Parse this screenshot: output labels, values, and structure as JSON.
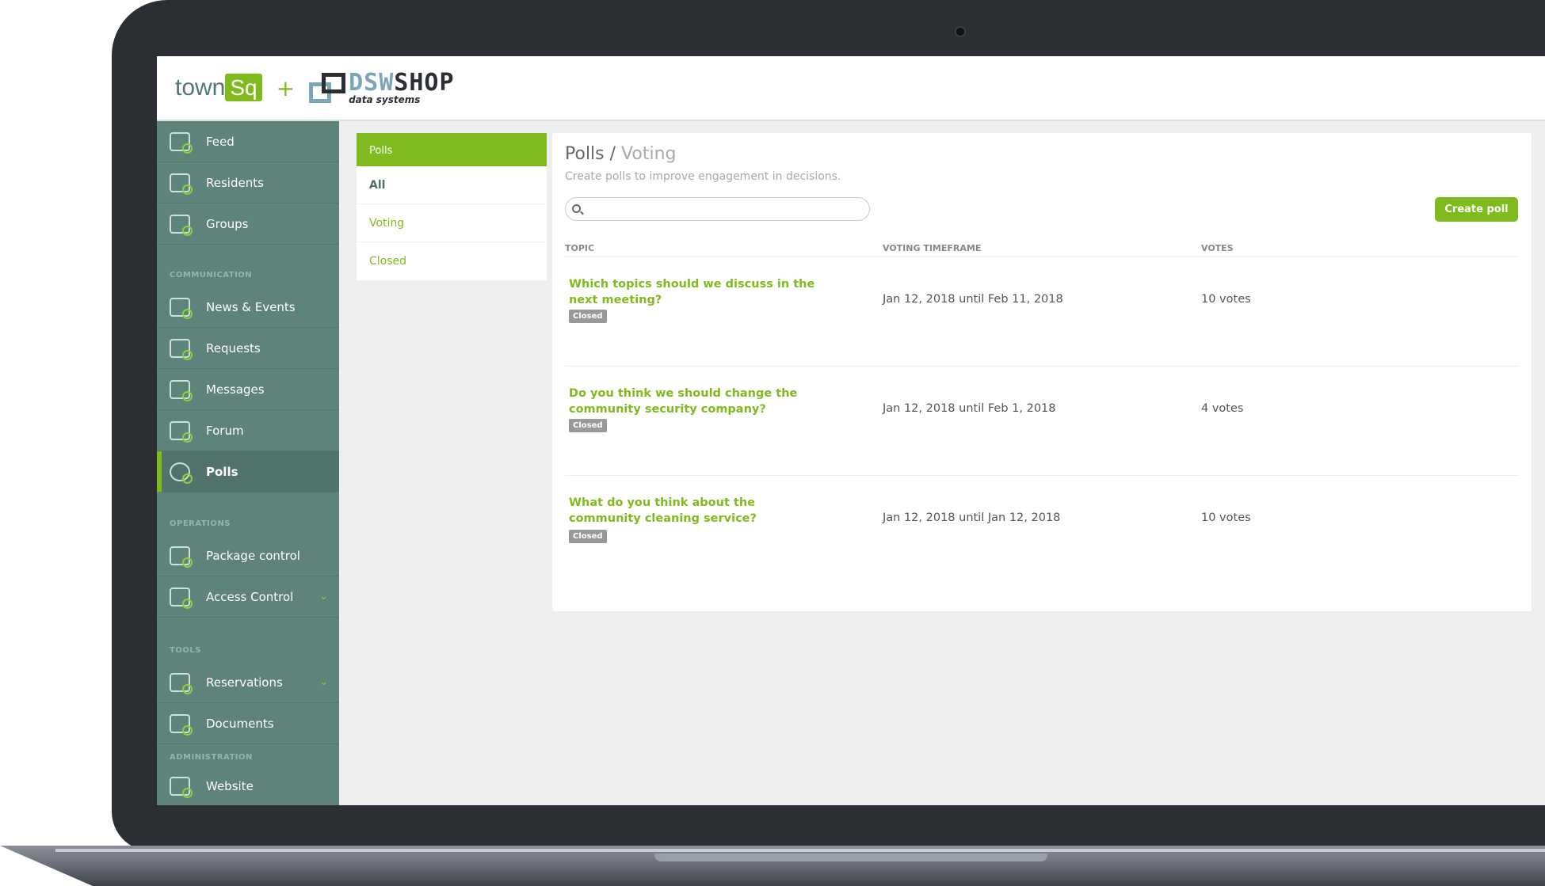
{
  "header": {
    "logo_left": "townSq",
    "logo_plus": "+",
    "logo_right": "DSWSHOP",
    "logo_right_sub": "data systems"
  },
  "sidebar": {
    "items": [
      {
        "label": "Feed",
        "icon": "feed-icon"
      },
      {
        "label": "Residents",
        "icon": "residents-icon"
      },
      {
        "label": "Groups",
        "icon": "groups-icon"
      },
      {
        "label": "News & Events",
        "icon": "news-events-icon"
      },
      {
        "label": "Requests",
        "icon": "requests-icon"
      },
      {
        "label": "Messages",
        "icon": "messages-icon"
      },
      {
        "label": "Forum",
        "icon": "forum-icon"
      },
      {
        "label": "Polls",
        "icon": "polls-icon",
        "active": true
      },
      {
        "label": "Package control",
        "icon": "package-icon"
      },
      {
        "label": "Access Control",
        "icon": "key-icon",
        "expandable": true
      },
      {
        "label": "Reservations",
        "icon": "calendar-icon",
        "expandable": true
      },
      {
        "label": "Documents",
        "icon": "document-icon"
      },
      {
        "label": "Website",
        "icon": "website-icon"
      }
    ],
    "sections": [
      "COMMUNICATION",
      "OPERATIONS",
      "TOOLS",
      "ADMINISTRATION"
    ]
  },
  "subnav": {
    "header": "Polls",
    "items": [
      "All",
      "Voting",
      "Closed"
    ]
  },
  "main": {
    "title": "Polls /",
    "title_sub": "Voting",
    "subtitle": "Create polls to improve engagement in decisions.",
    "search_value": "",
    "create_label": "Create poll",
    "columns": [
      "TOPIC",
      "VOTING TIMEFRAME",
      "VOTES"
    ],
    "rows": [
      {
        "topic": "Which topics should we discuss in the next meeting?",
        "status": "Closed",
        "timeframe": "Jan 12, 2018 until Feb 11, 2018",
        "votes": "10 votes"
      },
      {
        "topic": "Do you think we should change the community security company?",
        "status": "Closed",
        "timeframe": "Jan 12, 2018 until Feb 1, 2018",
        "votes": "4 votes"
      },
      {
        "topic": "What do you think about the community cleaning service?",
        "status": "Closed",
        "timeframe": "Jan 12, 2018 until Jan 12, 2018",
        "votes": "10 votes"
      }
    ]
  },
  "colors": {
    "accent": "#7fbb1c",
    "sidebar": "#5e837b",
    "sidebar_active": "#52736c",
    "badge": "#999999"
  }
}
